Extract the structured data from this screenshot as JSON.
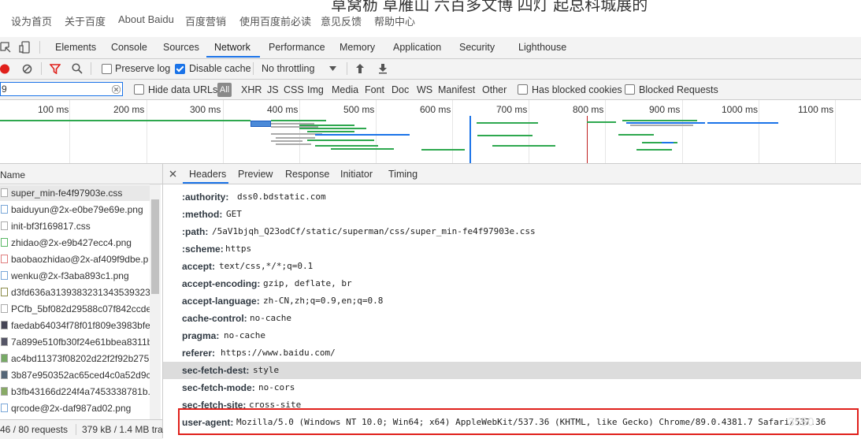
{
  "baidu_bar": {
    "links": [
      "设为首页",
      "关于百度",
      "About Baidu",
      "百度营销",
      "使用百度前必读",
      "意见反馈",
      "帮助中心"
    ],
    "background_text": "草窝枥 草雁山 六百多文博 四灯 起总科城展的"
  },
  "devtools": {
    "tabs": [
      "Elements",
      "Console",
      "Sources",
      "Network",
      "Performance",
      "Memory",
      "Application",
      "Security",
      "Lighthouse"
    ],
    "active_tab": "Network",
    "toolbar": {
      "preserve_log": "Preserve log",
      "disable_cache": "Disable cache",
      "throttling": "No throttling"
    },
    "filter": {
      "value": "9",
      "hide_data_urls": "Hide data URLs",
      "all": "All",
      "types": [
        "XHR",
        "JS",
        "CSS",
        "Img",
        "Media",
        "Font",
        "Doc",
        "WS",
        "Manifest",
        "Other"
      ],
      "has_blocked_cookies": "Has blocked cookies",
      "blocked_requests": "Blocked Requests"
    },
    "overview_ticks": [
      "100 ms",
      "200 ms",
      "300 ms",
      "400 ms",
      "500 ms",
      "600 ms",
      "700 ms",
      "800 ms",
      "900 ms",
      "1000 ms",
      "1100 ms"
    ],
    "list": {
      "header": "Name",
      "items": [
        "super_min-fe4f97903e.css",
        "baiduyun@2x-e0be79e69e.png",
        "init-bf3f169817.css",
        "zhidao@2x-e9b427ecc4.png",
        "baobaozhidao@2x-af409f9dbe.p",
        "wenku@2x-f3aba893c1.png",
        "d3fd636a3139383231343539323",
        "PCfb_5bf082d29588c07f842ccde",
        "faedab64034f78f01f809e3983bfe",
        "7a899e510fb30f24e61bbea8311b",
        "ac4bd11373f08202d22f2f92b275",
        "3b87e950352ac65ced4c0a52d9c",
        "b3fb43166d224f4a7453338781b.",
        "qrcode@2x-daf987ad02.png"
      ],
      "status_requests": "46 / 80 requests",
      "status_size": "379 kB / 1.4 MB tra"
    },
    "detail_tabs": [
      "Headers",
      "Preview",
      "Response",
      "Initiator",
      "Timing"
    ],
    "active_detail_tab": "Headers",
    "headers": [
      {
        "k": ":authority:",
        "v": "dss0.bdstatic.com"
      },
      {
        "k": ":method:",
        "v": "GET"
      },
      {
        "k": ":path:",
        "v": "/5aV1bjqh_Q23odCf/static/superman/css/super_min-fe4f97903e.css"
      },
      {
        "k": ":scheme:",
        "v": "https"
      },
      {
        "k": "accept:",
        "v": "text/css,*/*;q=0.1"
      },
      {
        "k": "accept-encoding:",
        "v": "gzip, deflate, br"
      },
      {
        "k": "accept-language:",
        "v": "zh-CN,zh;q=0.9,en;q=0.8"
      },
      {
        "k": "cache-control:",
        "v": "no-cache"
      },
      {
        "k": "pragma:",
        "v": "no-cache"
      },
      {
        "k": "referer:",
        "v": "https://www.baidu.com/"
      },
      {
        "k": "sec-fetch-dest:",
        "v": "style"
      },
      {
        "k": "sec-fetch-mode:",
        "v": "no-cors"
      },
      {
        "k": "sec-fetch-site:",
        "v": "cross-site"
      },
      {
        "k": "user-agent:",
        "v": "Mozilla/5.0 (Windows NT 10.0; Win64; x64) AppleWebKit/537.36 (KHTML, like Gecko) Chrome/89.0.4381.7 Safari/537.36"
      }
    ],
    "watermark": "3550"
  },
  "colors": {
    "accent": "#1a73e8",
    "record": "#e0201b",
    "highlight": "#e0201b"
  }
}
